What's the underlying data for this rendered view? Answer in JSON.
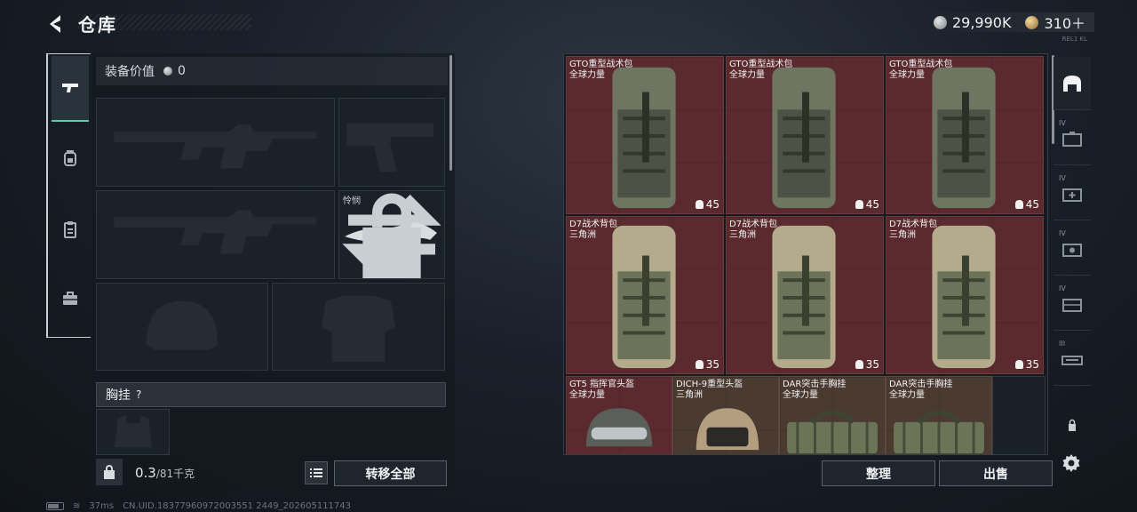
{
  "header": {
    "title": "仓库",
    "currency_silver": "29,990K",
    "currency_gold": "310＋",
    "signal_version": "REL1 KL"
  },
  "left_tabs": [
    {
      "name": "weapons-tab",
      "icon": "pistol-icon",
      "active": true
    },
    {
      "name": "gear-tab",
      "icon": "backpack-icon",
      "active": false
    },
    {
      "name": "clipboard-tab",
      "icon": "clipboard-icon",
      "active": false
    },
    {
      "name": "toolkit-tab",
      "icon": "toolbox-icon",
      "active": false
    }
  ],
  "equipment": {
    "value_label": "装备价值",
    "value": "0",
    "melee_label": "怜悯",
    "chest_rig_label": "胸挂",
    "chest_rig_help": "?",
    "weight": "0.3",
    "weight_max": "/81千克",
    "transfer_all": "转移全部"
  },
  "warehouse": {
    "items": [
      {
        "name": "GTO重型战术包",
        "sub": "全球力量",
        "qty": "45"
      },
      {
        "name": "GTO重型战术包",
        "sub": "全球力量",
        "qty": "45"
      },
      {
        "name": "GTO重型战术包",
        "sub": "全球力量",
        "qty": "45"
      },
      {
        "name": "D7战术背包",
        "sub": "三角洲",
        "qty": "35"
      },
      {
        "name": "D7战术背包",
        "sub": "三角洲",
        "qty": "35"
      },
      {
        "name": "D7战术背包",
        "sub": "三角洲",
        "qty": "35"
      }
    ],
    "small_items": [
      {
        "name": "GT5 指挥官头盔",
        "sub": "全球力量"
      },
      {
        "name": "DICH-9重型头盔",
        "sub": "三角洲"
      },
      {
        "name": "DAR突击手胸挂",
        "sub": "全球力量"
      },
      {
        "name": "DAR突击手胸挂",
        "sub": "全球力量"
      }
    ],
    "sort_label": "整理",
    "sell_label": "出售"
  },
  "right_categories": [
    {
      "tier": "",
      "icon": "helmet-icon",
      "active": true
    },
    {
      "tier": "IV",
      "icon": "case-icon"
    },
    {
      "tier": "IV",
      "icon": "medkit-case-icon"
    },
    {
      "tier": "IV",
      "icon": "ammo-case-icon"
    },
    {
      "tier": "IV",
      "icon": "case-icon"
    },
    {
      "tier": "III",
      "icon": "weapon-case-icon"
    },
    {
      "tier": "",
      "icon": "lock-icon"
    }
  ],
  "status": {
    "ping": "37ms",
    "uid": "CN.UID.18377960972003551 2449_202605111743"
  },
  "colors": {
    "accent": "#5fc9a8",
    "item_bg_red": "#5a2a2e",
    "item_bg_tan": "#4a3a30"
  }
}
